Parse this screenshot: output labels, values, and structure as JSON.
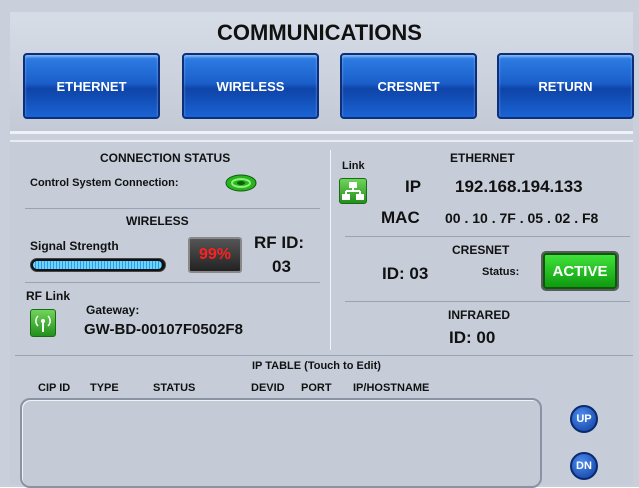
{
  "header": {
    "title": "COMMUNICATIONS"
  },
  "nav": {
    "ethernet": "ETHERNET",
    "wireless": "WIRELESS",
    "cresnet": "CRESNET",
    "return": "RETURN"
  },
  "connection_status": {
    "heading": "CONNECTION STATUS",
    "label": "Control System Connection:"
  },
  "wireless": {
    "heading": "WIRELESS",
    "signal_label": "Signal Strength",
    "signal_percent": "99%",
    "signal_fraction": 0.99,
    "rf_id_label": "RF ID:",
    "rf_id_value": "03",
    "rf_link_label": "RF Link",
    "gateway_label": "Gateway:",
    "gateway_value": "GW-BD-00107F0502F8"
  },
  "ethernet": {
    "link_label": "Link",
    "heading": "ETHERNET",
    "ip_label": "IP",
    "ip_value": "192.168.194.133",
    "mac_label": "MAC",
    "mac_value": "00 . 10 . 7F . 05 . 02 . F8"
  },
  "cresnet": {
    "heading": "CRESNET",
    "id_text": "ID: 03",
    "status_label": "Status:",
    "status_value": "ACTIVE"
  },
  "infrared": {
    "heading": "INFRARED",
    "id_text": "ID: 00"
  },
  "ip_table": {
    "title": "IP TABLE (Touch to Edit)",
    "columns": [
      "CIP ID",
      "TYPE",
      "STATUS",
      "DEVID",
      "PORT",
      "IP/HOSTNAME"
    ],
    "up_label": "UP",
    "dn_label": "DN"
  },
  "colors": {
    "accent_blue": "#1b5fcb",
    "active_green": "#1fb81c",
    "warning_red": "#ff2020"
  }
}
